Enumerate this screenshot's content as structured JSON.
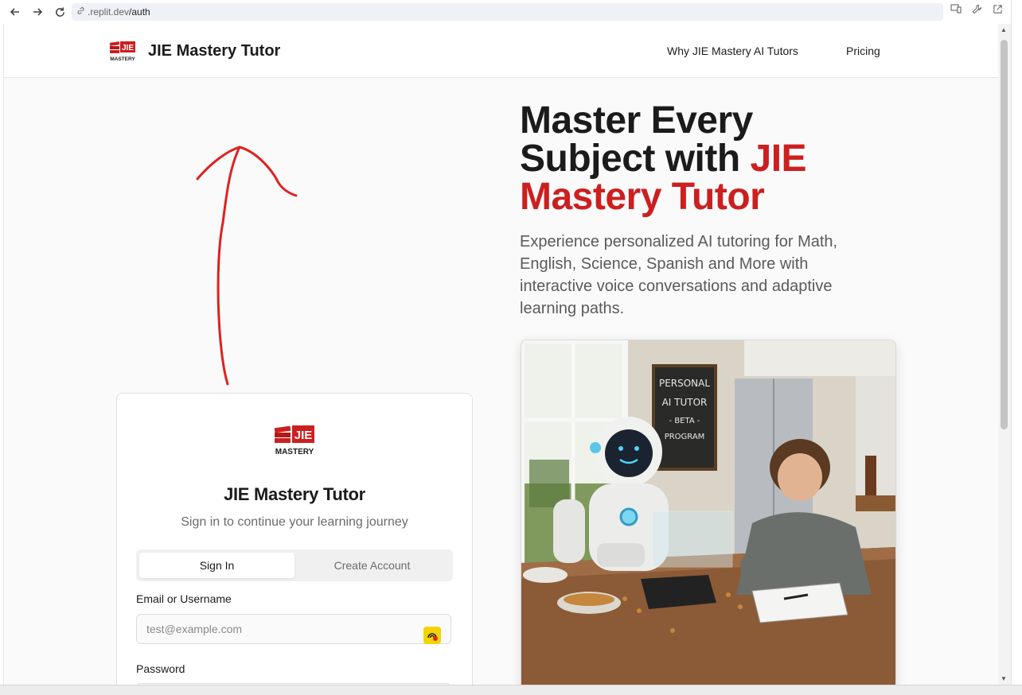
{
  "browser": {
    "url_prefix": ".replit.dev",
    "url_path": "/auth"
  },
  "header": {
    "brand_name": "JIE Mastery Tutor",
    "logo_text_top": "JIE",
    "logo_text_bottom": "MASTERY",
    "nav": [
      {
        "label": "Why JIE Mastery AI Tutors"
      },
      {
        "label": "Pricing"
      }
    ]
  },
  "hero": {
    "title_line1": "Master Every",
    "title_line2_plain": "Subject with ",
    "title_line2_accent": "JIE",
    "title_line3_accent": "Mastery Tutor",
    "subtitle": "Experience personalized AI tutoring for Math, English, Science, Spanish and More with interactive voice conversations and adaptive learning paths.",
    "image": {
      "chalkboard_line1": "PERSONAL",
      "chalkboard_line2": "AI TUTOR",
      "chalkboard_line3": "- BETA -",
      "chalkboard_line4": "PROGRAM"
    }
  },
  "auth": {
    "logo_text_top": "JIE",
    "logo_text_bottom": "MASTERY",
    "title": "JIE Mastery Tutor",
    "subtitle": "Sign in to continue your learning journey",
    "tabs": [
      {
        "label": "Sign In",
        "active": true
      },
      {
        "label": "Create Account",
        "active": false
      }
    ],
    "email_label": "Email or Username",
    "email_placeholder": "test@example.com",
    "password_label": "Password"
  },
  "colors": {
    "accent": "#cc1f1f",
    "annotation": "#e02020"
  }
}
